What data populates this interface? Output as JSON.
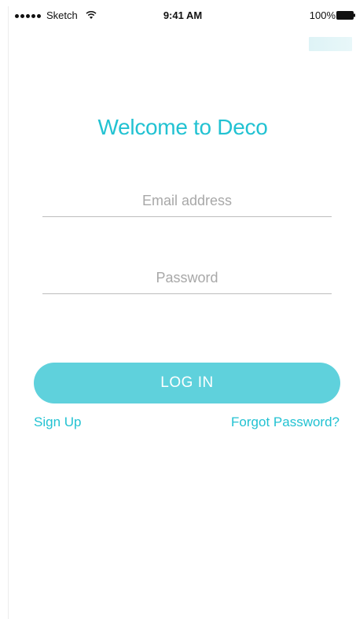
{
  "status_bar": {
    "carrier": "Sketch",
    "time": "9:41 AM",
    "battery": "100%"
  },
  "login": {
    "title": "Welcome to Deco",
    "email_placeholder": "Email address",
    "email_value": "",
    "password_placeholder": "Password",
    "password_value": "",
    "login_label": "LOG IN",
    "signup_label": "Sign Up",
    "forgot_label": "Forgot Password?"
  },
  "colors": {
    "accent": "#22c2d2",
    "button": "#5fd1dc",
    "placeholder": "#a8a8a8",
    "divider": "#bdbdbd"
  },
  "icons": {
    "signal": "signal-strength-icon",
    "wifi": "wifi-icon",
    "battery": "battery-icon"
  }
}
